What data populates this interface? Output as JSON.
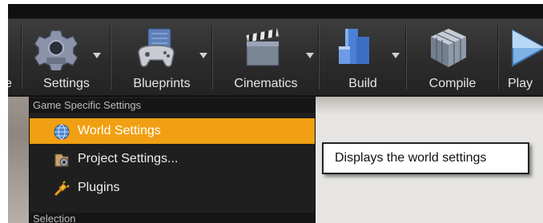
{
  "toolbar": {
    "partial_label": "e",
    "items": [
      {
        "label": "Settings",
        "icon": "gear-icon"
      },
      {
        "label": "Blueprints",
        "icon": "gamepad-icon"
      },
      {
        "label": "Cinematics",
        "icon": "clapperboard-icon"
      },
      {
        "label": "Build",
        "icon": "blocks-icon"
      },
      {
        "label": "Compile",
        "icon": "cube-icon"
      },
      {
        "label": "Play",
        "icon": "play-icon"
      }
    ]
  },
  "settings_menu": {
    "section_game": "Game Specific Settings",
    "items": [
      {
        "label": "World Settings",
        "icon": "globe-icon",
        "selected": true
      },
      {
        "label": "Project Settings...",
        "icon": "project-settings-icon",
        "selected": false
      },
      {
        "label": "Plugins",
        "icon": "plug-icon",
        "selected": false
      }
    ],
    "section_selection": "Selection"
  },
  "tooltip": {
    "text": "Displays the world settings"
  },
  "colors": {
    "highlight": "#f0a012",
    "toolbar": "#333333",
    "menu_bg": "#1f1f1f"
  }
}
